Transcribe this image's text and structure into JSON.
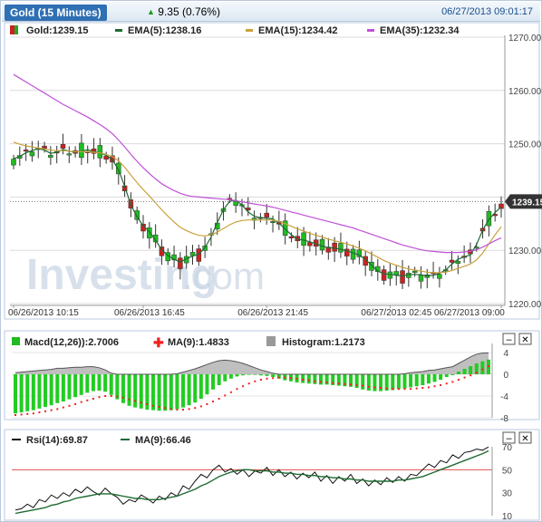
{
  "header": {
    "title": "Gold (15 Minutes)",
    "change": "9.35 (0.76%)",
    "datetime": "06/27/2013 09:01:17"
  },
  "main_legend": [
    {
      "label": "Gold:1239.15",
      "color": "#cc2222"
    },
    {
      "label": "EMA(5):1238.16",
      "color": "#1e6b32"
    },
    {
      "label": "EMA(15):1234.42",
      "color": "#c9a23a"
    },
    {
      "label": "EMA(35):1232.34",
      "color": "#c050d8"
    }
  ],
  "watermark": {
    "part1": "Investing",
    "part2": ".com"
  },
  "price_tag": "1239.15",
  "macd_legend": [
    {
      "label": "Macd(12,26)):2.7006",
      "color": "#22bb22"
    },
    {
      "label": "MA(9):1.4833",
      "color": "#ee2222"
    },
    {
      "label": "Histogram:1.2173",
      "color": "#999999"
    }
  ],
  "rsi_legend": [
    {
      "label": "Rsi(14):69.87",
      "color": "#111111"
    },
    {
      "label": "MA(9):66.46",
      "color": "#1e6b32"
    }
  ],
  "close_glyph": "✕",
  "minimize_glyph": "–",
  "chart_data": [
    {
      "type": "candlestick",
      "ylim": [
        1220,
        1270
      ],
      "y_ticks": [
        "1270.00",
        "1260.00",
        "1250.00",
        "1240.00",
        "1230.00",
        "1220.00"
      ],
      "x_ticks": [
        "06/26/2013 10:15",
        "06/26/2013 16:45",
        "06/26/2013 21:45",
        "06/27/2013 02:45",
        "06/27/2013 09:00"
      ],
      "series": [
        {
          "name": "Gold",
          "last": 1239.15
        },
        {
          "name": "EMA(5)",
          "last": 1238.16,
          "color": "#1e6b32",
          "values": [
            1247.2,
            1247.6,
            1248.3,
            1248.7,
            1249.1,
            1248.8,
            1248.2,
            1248.4,
            1248.9,
            1248.6,
            1248.4,
            1248.6,
            1248.9,
            1248.5,
            1248.3,
            1247.8,
            1247.0,
            1245.1,
            1242.0,
            1238.5,
            1236.3,
            1234.6,
            1233.5,
            1231.9,
            1230.1,
            1229.0,
            1228.3,
            1227.8,
            1228.4,
            1228.9,
            1229.3,
            1230.5,
            1232.5,
            1235.2,
            1237.6,
            1239.2,
            1239.4,
            1238.5,
            1237.2,
            1236.4,
            1236.1,
            1236.0,
            1235.9,
            1235.1,
            1234.0,
            1232.9,
            1232.1,
            1231.9,
            1231.6,
            1231.2,
            1230.8,
            1230.5,
            1230.4,
            1230.2,
            1229.9,
            1229.5,
            1229.1,
            1228.3,
            1227.2,
            1226.1,
            1225.6,
            1225.5,
            1225.3,
            1225.2,
            1225.4,
            1225.5,
            1225.4,
            1225.2,
            1225.3,
            1225.7,
            1226.3,
            1227.4,
            1228.3,
            1228.8,
            1229.1,
            1231.1,
            1233.8,
            1235.8,
            1237.1,
            1238.16
          ]
        },
        {
          "name": "EMA(15)",
          "last": 1234.42,
          "color": "#c9a23a",
          "values": [
            1250.3,
            1249.9,
            1249.6,
            1249.4,
            1249.2,
            1249.0,
            1248.8,
            1248.7,
            1248.7,
            1248.6,
            1248.5,
            1248.5,
            1248.5,
            1248.4,
            1248.3,
            1248.0,
            1247.6,
            1246.8,
            1245.6,
            1244.1,
            1242.7,
            1241.4,
            1240.2,
            1238.9,
            1237.6,
            1236.4,
            1235.3,
            1234.3,
            1233.7,
            1233.2,
            1232.8,
            1232.7,
            1232.9,
            1233.4,
            1234.1,
            1234.8,
            1235.3,
            1235.6,
            1235.7,
            1235.7,
            1235.7,
            1235.7,
            1235.7,
            1235.4,
            1235.0,
            1234.5,
            1234.0,
            1233.6,
            1233.2,
            1232.8,
            1232.5,
            1232.1,
            1231.8,
            1231.5,
            1231.2,
            1230.8,
            1230.4,
            1229.9,
            1229.3,
            1228.7,
            1228.1,
            1227.6,
            1227.2,
            1226.8,
            1226.5,
            1226.3,
            1226.1,
            1225.9,
            1225.8,
            1225.8,
            1225.9,
            1226.2,
            1226.6,
            1227.0,
            1227.4,
            1228.2,
            1229.5,
            1231.2,
            1232.9,
            1234.42
          ]
        },
        {
          "name": "EMA(35)",
          "last": 1232.34,
          "color": "#c050d8",
          "values": [
            1263.0,
            1262.3,
            1261.6,
            1260.9,
            1260.2,
            1259.5,
            1258.8,
            1258.1,
            1257.4,
            1256.8,
            1256.2,
            1255.6,
            1255.0,
            1254.3,
            1253.6,
            1252.8,
            1251.9,
            1250.7,
            1249.4,
            1248.0,
            1246.7,
            1245.5,
            1244.4,
            1243.4,
            1242.5,
            1241.8,
            1241.2,
            1240.7,
            1240.3,
            1240.1,
            1240.0,
            1239.9,
            1239.8,
            1239.7,
            1239.6,
            1239.5,
            1239.3,
            1239.1,
            1238.9,
            1238.7,
            1238.5,
            1238.3,
            1238.1,
            1237.8,
            1237.5,
            1237.2,
            1236.9,
            1236.6,
            1236.3,
            1236.0,
            1235.7,
            1235.4,
            1235.1,
            1234.8,
            1234.5,
            1234.2,
            1233.8,
            1233.4,
            1233.0,
            1232.6,
            1232.2,
            1231.8,
            1231.4,
            1231.0,
            1230.7,
            1230.4,
            1230.1,
            1229.9,
            1229.8,
            1229.7,
            1229.6,
            1229.6,
            1229.6,
            1229.7,
            1229.8,
            1230.1,
            1230.6,
            1231.2,
            1231.8,
            1232.34
          ]
        }
      ]
    },
    {
      "type": "macd",
      "ylim": [
        -8,
        5
      ],
      "y_ticks": [
        "4",
        "0",
        "-4",
        "-8"
      ],
      "series": [
        {
          "name": "Macd(12,26))",
          "last": 2.7006,
          "values": [
            -7.2,
            -7.0,
            -6.8,
            -6.6,
            -6.3,
            -6.0,
            -5.7,
            -5.3,
            -5.0,
            -4.6,
            -4.2,
            -3.8,
            -3.4,
            -3.1,
            -3.0,
            -3.2,
            -3.8,
            -4.6,
            -5.3,
            -5.8,
            -6.1,
            -6.3,
            -6.5,
            -6.6,
            -6.7,
            -6.7,
            -6.6,
            -6.4,
            -6.1,
            -5.7,
            -5.2,
            -4.5,
            -3.7,
            -2.8,
            -2.0,
            -1.3,
            -0.8,
            -0.4,
            -0.2,
            -0.1,
            -0.1,
            -0.2,
            -0.3,
            -0.5,
            -0.8,
            -1.1,
            -1.3,
            -1.5,
            -1.6,
            -1.7,
            -1.8,
            -1.9,
            -1.9,
            -2.0,
            -2.1,
            -2.2,
            -2.3,
            -2.5,
            -2.8,
            -3.0,
            -3.1,
            -3.1,
            -3.0,
            -2.9,
            -2.7,
            -2.6,
            -2.4,
            -2.2,
            -2.0,
            -1.7,
            -1.4,
            -1.0,
            -0.5,
            0.0,
            0.5,
            1.0,
            1.5,
            2.0,
            2.4,
            2.7
          ]
        },
        {
          "name": "MA(9)",
          "last": 1.4833,
          "values": [
            -7.5,
            -7.4,
            -7.3,
            -7.2,
            -7.0,
            -6.8,
            -6.6,
            -6.4,
            -6.1,
            -5.8,
            -5.5,
            -5.1,
            -4.8,
            -4.5,
            -4.2,
            -4.0,
            -4.0,
            -4.1,
            -4.3,
            -4.6,
            -4.9,
            -5.2,
            -5.5,
            -5.8,
            -6.0,
            -6.2,
            -6.4,
            -6.5,
            -6.5,
            -6.4,
            -6.2,
            -5.9,
            -5.5,
            -5.0,
            -4.5,
            -3.9,
            -3.3,
            -2.7,
            -2.2,
            -1.7,
            -1.3,
            -1.0,
            -0.8,
            -0.7,
            -0.6,
            -0.6,
            -0.7,
            -0.8,
            -1.0,
            -1.1,
            -1.3,
            -1.4,
            -1.5,
            -1.6,
            -1.7,
            -1.8,
            -1.9,
            -2.0,
            -2.1,
            -2.3,
            -2.4,
            -2.5,
            -2.6,
            -2.7,
            -2.7,
            -2.7,
            -2.7,
            -2.6,
            -2.5,
            -2.4,
            -2.2,
            -2.0,
            -1.7,
            -1.4,
            -1.0,
            -0.6,
            -0.2,
            0.3,
            0.9,
            1.48
          ]
        }
      ]
    },
    {
      "type": "rsi",
      "ylim": [
        10,
        70
      ],
      "y_ticks": [
        "70",
        "50",
        "30",
        "10"
      ],
      "series": [
        {
          "name": "Rsi(14)",
          "last": 69.87,
          "values": [
            15,
            16,
            20,
            17,
            24,
            22,
            28,
            25,
            30,
            27,
            33,
            30,
            35,
            31,
            28,
            34,
            29,
            26,
            20,
            24,
            22,
            28,
            25,
            21,
            27,
            24,
            30,
            27,
            36,
            33,
            40,
            46,
            43,
            50,
            54,
            48,
            51,
            46,
            50,
            44,
            49,
            47,
            52,
            45,
            50,
            44,
            48,
            42,
            47,
            43,
            48,
            40,
            45,
            38,
            44,
            40,
            46,
            38,
            42,
            36,
            41,
            37,
            43,
            39,
            44,
            40,
            46,
            45,
            50,
            55,
            52,
            58,
            56,
            63,
            60,
            65,
            66,
            68,
            67,
            69.87
          ]
        },
        {
          "name": "MA(9)",
          "last": 66.46,
          "values": [
            12,
            13,
            14,
            15,
            16,
            17,
            19,
            20,
            22,
            23,
            25,
            26,
            27,
            28,
            29,
            29,
            29,
            28,
            27,
            26,
            25,
            25,
            24,
            24,
            24,
            25,
            26,
            27,
            29,
            31,
            33,
            36,
            38,
            41,
            44,
            46,
            48,
            49,
            50,
            50,
            49,
            49,
            49,
            48,
            48,
            47,
            47,
            46,
            46,
            45,
            45,
            44,
            44,
            43,
            43,
            42,
            42,
            41,
            41,
            40,
            40,
            40,
            40,
            40,
            41,
            41,
            42,
            43,
            44,
            46,
            48,
            50,
            52,
            54,
            56,
            58,
            60,
            62,
            64,
            66.46
          ]
        }
      ]
    }
  ]
}
